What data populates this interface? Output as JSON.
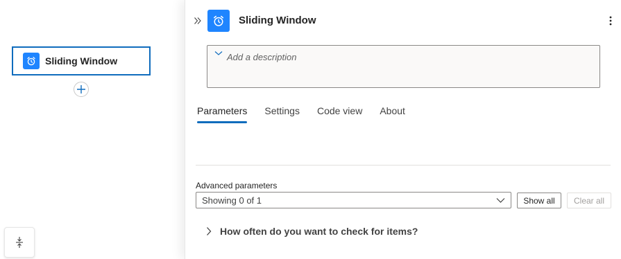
{
  "canvas": {
    "node": {
      "title": "Sliding Window",
      "icon": "alarm-clock-icon"
    },
    "add_button_icon": "plus-icon",
    "fit_button_icon": "fit-vertical-icon"
  },
  "panel": {
    "collapse_icon": "double-chevron-right-icon",
    "title": "Sliding Window",
    "icon": "alarm-clock-icon",
    "more_icon": "more-vertical-icon",
    "description_placeholder": "Add a description",
    "tabs": [
      {
        "label": "Parameters",
        "active": true
      },
      {
        "label": "Settings",
        "active": false
      },
      {
        "label": "Code view",
        "active": false
      },
      {
        "label": "About",
        "active": false
      }
    ],
    "advanced": {
      "label": "Advanced parameters",
      "select_value": "Showing 0 of 1",
      "show_all_label": "Show all",
      "clear_all_label": "Clear all"
    },
    "section_label": "How often do you want to check for items?"
  },
  "colors": {
    "accent": "#0f6cbd",
    "icon_bg": "#1f85ff"
  }
}
